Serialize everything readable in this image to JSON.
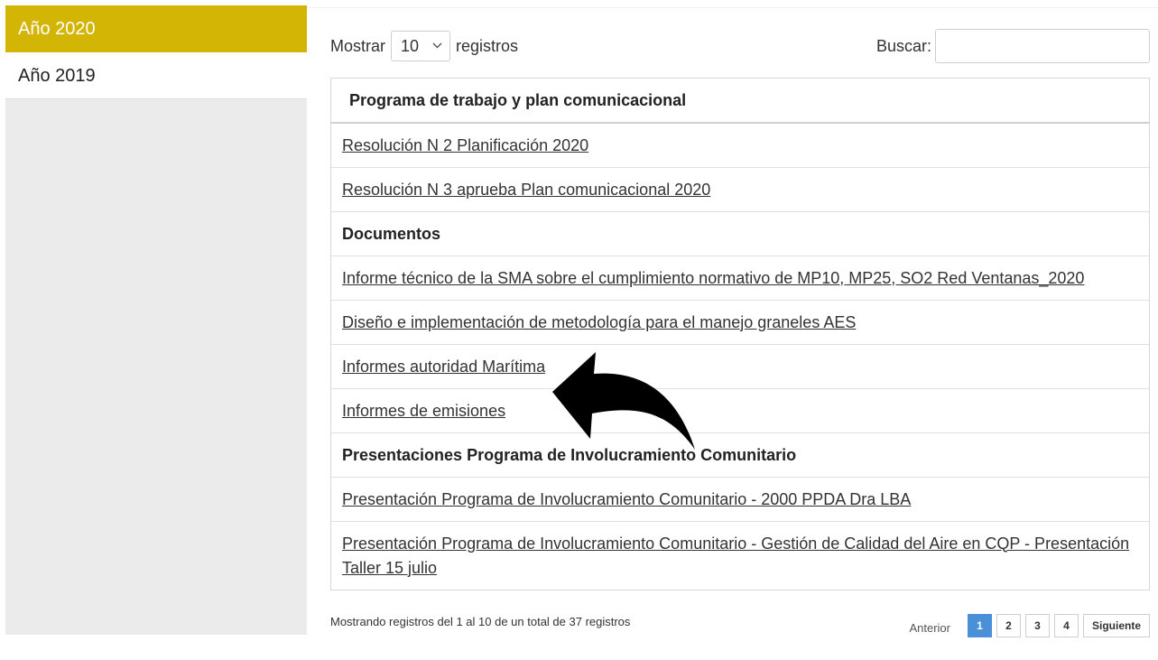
{
  "sidebar": {
    "items": [
      {
        "label": "Año 2020",
        "active": true
      },
      {
        "label": "Año 2019",
        "active": false
      }
    ]
  },
  "controls": {
    "show_label": "Mostrar",
    "length_value": "10",
    "records_label": "registros",
    "search_label": "Buscar:",
    "search_value": ""
  },
  "table": {
    "header": "Programa de trabajo y plan comunicacional",
    "rows": [
      {
        "text": "Resolución N 2 Planificación 2020",
        "type": "link"
      },
      {
        "text": "Resolución N 3 aprueba Plan comunicacional 2020",
        "type": "link"
      },
      {
        "text": "Documentos",
        "type": "section"
      },
      {
        "text": "Informe técnico de la SMA sobre el cumplimiento normativo de MP10, MP25, SO2 Red Ventanas_2020",
        "type": "link"
      },
      {
        "text": "Diseño e implementación de metodología para el manejo graneles AES",
        "type": "link"
      },
      {
        "text": "Informes autoridad Marítima",
        "type": "link"
      },
      {
        "text": "Informes de emisiones",
        "type": "link"
      },
      {
        "text": "Presentaciones Programa de Involucramiento Comunitario",
        "type": "section"
      },
      {
        "text": "Presentación Programa de Involucramiento Comunitario - 2000 PPDA Dra LBA",
        "type": "link"
      },
      {
        "text": "Presentación Programa de Involucramiento Comunitario - Gestión de Calidad del Aire en CQP - Presentación Taller 15 julio",
        "type": "link"
      }
    ]
  },
  "footer": {
    "info": "Mostrando registros del 1 al 10 de un total de 37 registros",
    "prev_label": "Anterior",
    "pages": [
      "1",
      "2",
      "3",
      "4"
    ],
    "current_page": "1",
    "next_label": "Siguiente"
  },
  "colors": {
    "active_tab": "#d3b605",
    "current_page": "#4a90d9",
    "sidebar_bg": "#ebebeb"
  },
  "icons": {
    "overlay": "curved-arrow-icon",
    "dropdown": "chevron-down-icon"
  }
}
